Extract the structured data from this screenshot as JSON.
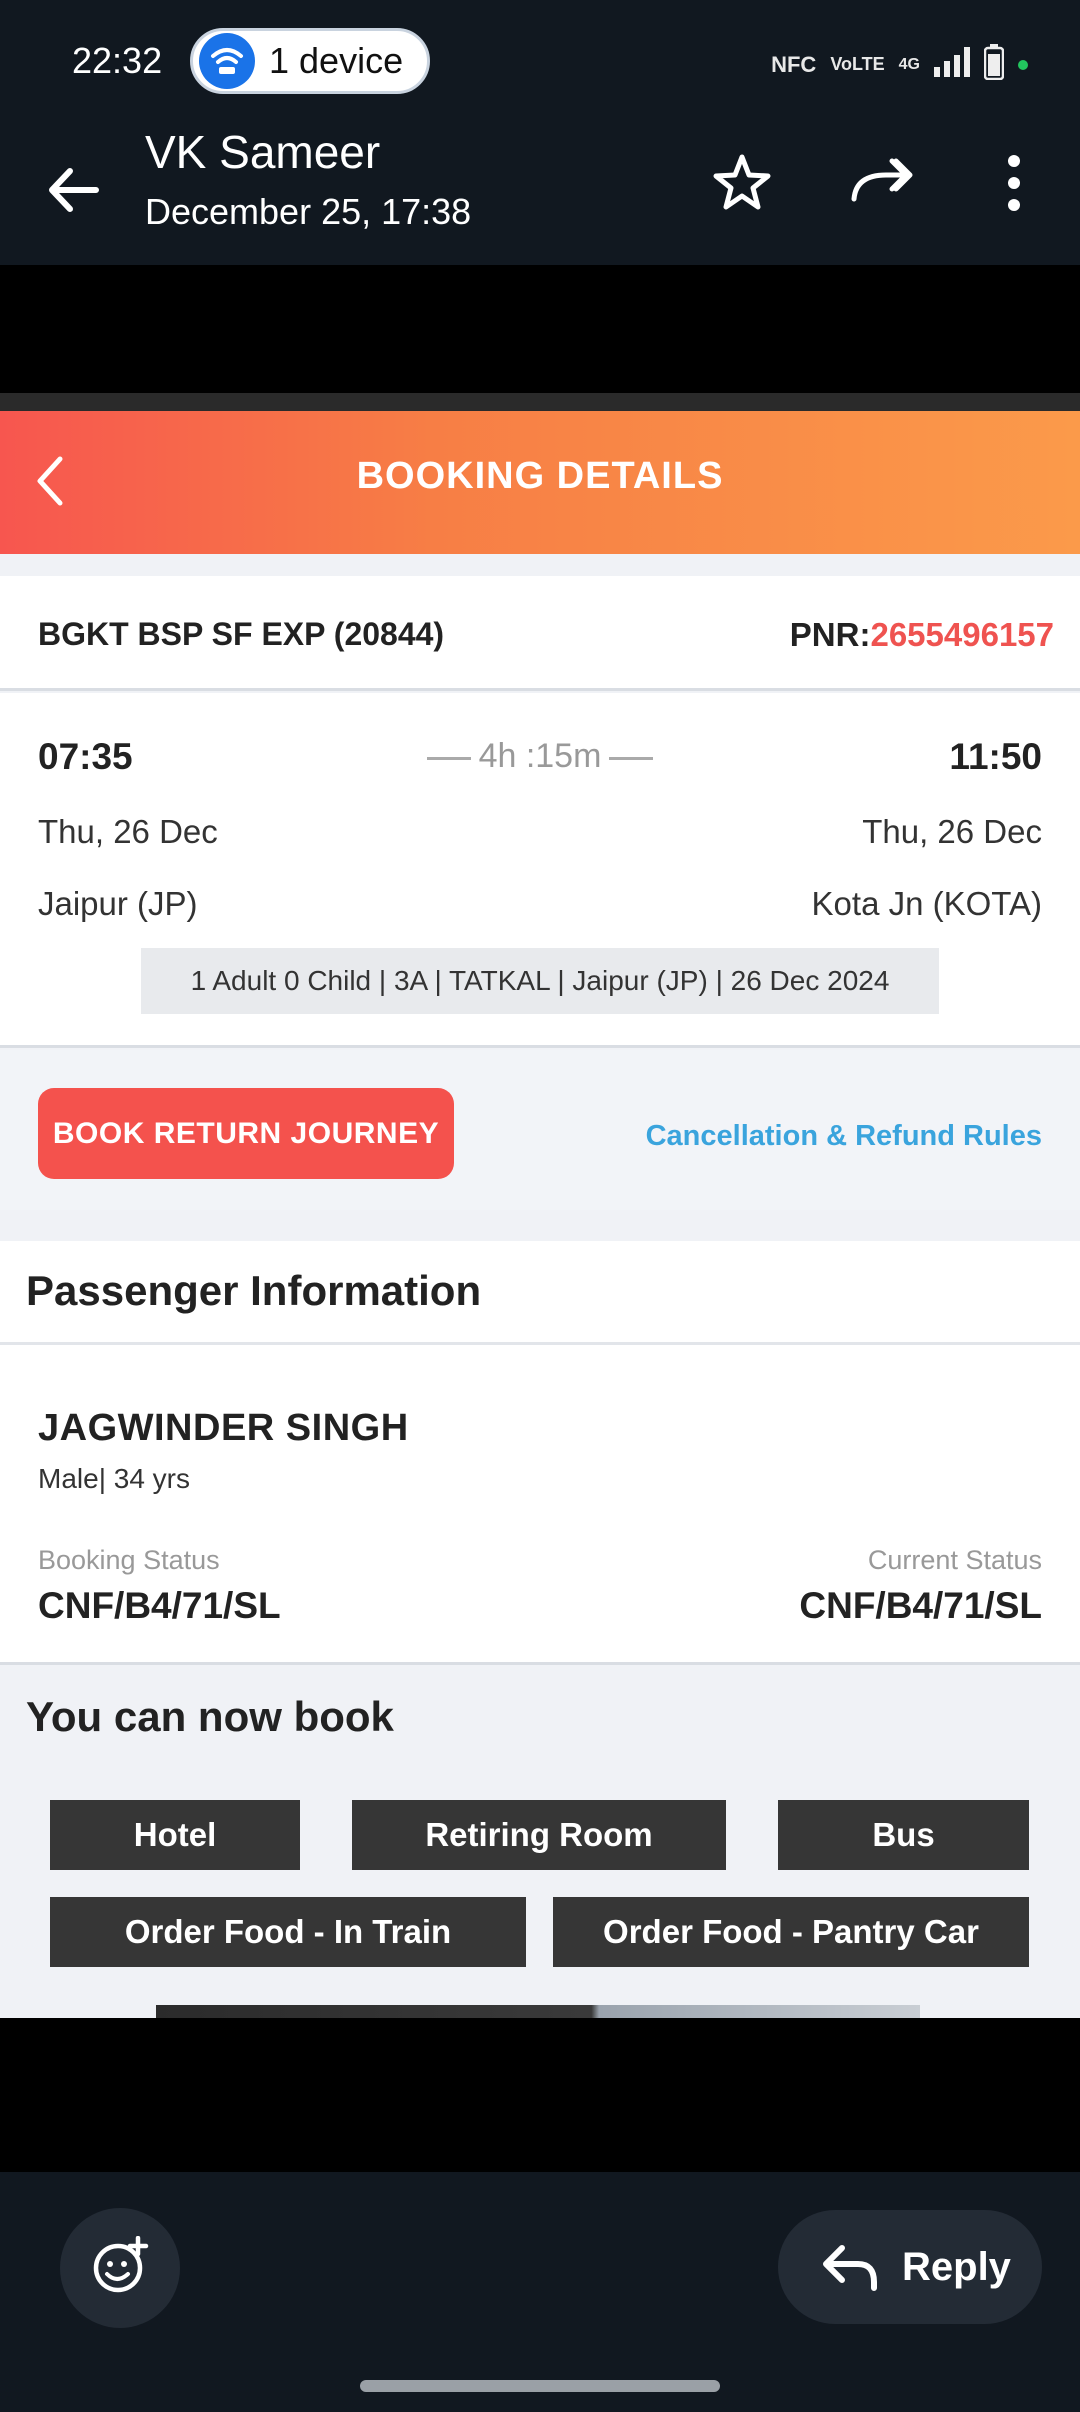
{
  "status_bar": {
    "time": "22:32",
    "device_pill": "1 device",
    "network_glyphs": [
      "NFC",
      "VoLTE",
      "4G"
    ],
    "icons": [
      "wifi-icon",
      "nfc-icon",
      "volte-icon",
      "signal-icon",
      "battery-icon"
    ],
    "dot_color": "#22c55e"
  },
  "app_bar": {
    "title": "VK Sameer",
    "subtitle": "December 25, 17:38",
    "icons": [
      "back-arrow-icon",
      "star-icon",
      "forward-icon",
      "more-vert-icon"
    ]
  },
  "booking": {
    "header_title": "BOOKING DETAILS",
    "train_name": "BGKT BSP SF EXP  (20844)",
    "pnr_label": "PNR:",
    "pnr_value": "2655496157",
    "dep_time": "07:35",
    "arr_time": "11:50",
    "duration": "4h :15m",
    "dep_date": "Thu, 26 Dec",
    "arr_date": "Thu, 26 Dec",
    "from_station": "Jaipur (JP)",
    "to_station": "Kota Jn (KOTA)",
    "summary": "1 Adult 0 Child  | 3A | TATKAL | Jaipur (JP) | 26 Dec 2024",
    "return_button": "BOOK RETURN JOURNEY",
    "refund_link": "Cancellation & Refund Rules",
    "accent": "#f4524d",
    "link_color": "#3aa4dd"
  },
  "passenger": {
    "section_title": "Passenger Information",
    "name": "JAGWINDER SINGH",
    "meta": "Male| 34 yrs",
    "booking_status_label": "Booking Status",
    "booking_status": "CNF/B4/71/SL",
    "current_status_label": "Current Status",
    "current_status": "CNF/B4/71/SL"
  },
  "book_more": {
    "title": "You can now book",
    "services": [
      "Hotel",
      "Retiring Room",
      "Bus",
      "Order Food - In Train",
      "Order Food - Pantry Car"
    ]
  },
  "bottom_bar": {
    "reply_label": "Reply",
    "icons": [
      "emoji-add-icon",
      "reply-icon"
    ]
  }
}
